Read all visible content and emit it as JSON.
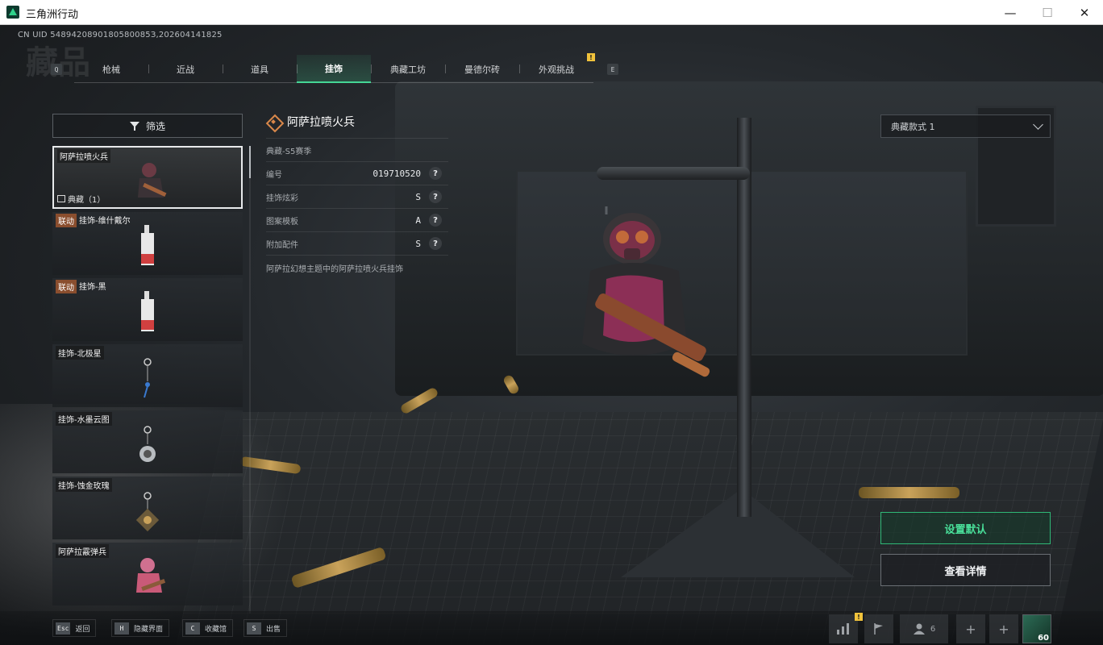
{
  "window": {
    "title": "三角洲行动",
    "minimize": "—",
    "maximize": "☐",
    "close": "✕"
  },
  "header": {
    "uid": "CN UID 5489420890180580085З,202604141825",
    "bg_title": "藏品",
    "key_left": "Q",
    "key_right": "E",
    "tabs": [
      {
        "label": "枪械",
        "active": false
      },
      {
        "label": "近战",
        "active": false
      },
      {
        "label": "道具",
        "active": false
      },
      {
        "label": "挂饰",
        "active": true
      },
      {
        "label": "典藏工坊",
        "active": false
      },
      {
        "label": "曼德尔砖",
        "active": false
      },
      {
        "label": "外观挑战",
        "active": false
      }
    ],
    "badge": "!"
  },
  "filter": {
    "label": "筛选"
  },
  "items": [
    {
      "name": "阿萨拉喷火兵",
      "tag": "",
      "sub": "典藏（1）",
      "selected": true,
      "icon": "flamethrower-charm"
    },
    {
      "name": "挂饰-维什戴尔",
      "tag": "联动",
      "sub": "",
      "selected": false,
      "icon": "tag-charm"
    },
    {
      "name": "挂饰-黑",
      "tag": "联动",
      "sub": "",
      "selected": false,
      "icon": "tag-charm"
    },
    {
      "name": "挂饰-北极星",
      "tag": "",
      "sub": "",
      "selected": false,
      "icon": "star-charm"
    },
    {
      "name": "挂饰-水墨云图",
      "tag": "",
      "sub": "",
      "selected": false,
      "icon": "ink-charm"
    },
    {
      "name": "挂饰-蚀金玫瑰",
      "tag": "",
      "sub": "",
      "selected": false,
      "icon": "rose-charm"
    },
    {
      "name": "阿萨拉霰弹兵",
      "tag": "",
      "sub": "",
      "selected": false,
      "icon": "shotgunner-charm"
    }
  ],
  "detail": {
    "title": "阿萨拉喷火兵",
    "season": "典藏-S5赛季",
    "rows": [
      {
        "label": "编号",
        "value": "019710520"
      },
      {
        "label": "挂饰炫彩",
        "value": "S"
      },
      {
        "label": "图案模板",
        "value": "A"
      },
      {
        "label": "附加配件",
        "value": "S"
      }
    ],
    "help": "?",
    "description": "阿萨拉幻想主题中的阿萨拉喷火兵挂饰"
  },
  "style_select": {
    "value": "典藏款式 1"
  },
  "actions": {
    "set_default": "设置默认",
    "view_detail": "查看详情"
  },
  "bottom_hints": [
    {
      "key": "Esc",
      "label": "返回"
    },
    {
      "key": "H",
      "label": "隐藏界面"
    },
    {
      "key": "C",
      "label": "收藏馆"
    },
    {
      "key": "S",
      "label": "出售"
    }
  ],
  "bottom_right": {
    "badge": "!",
    "friends_count": "6",
    "plus": "+",
    "avatar_level": "60"
  },
  "colors": {
    "accent": "#45d695",
    "tag_orange": "#8a4e2e",
    "badge_yellow": "#f0c23b"
  }
}
